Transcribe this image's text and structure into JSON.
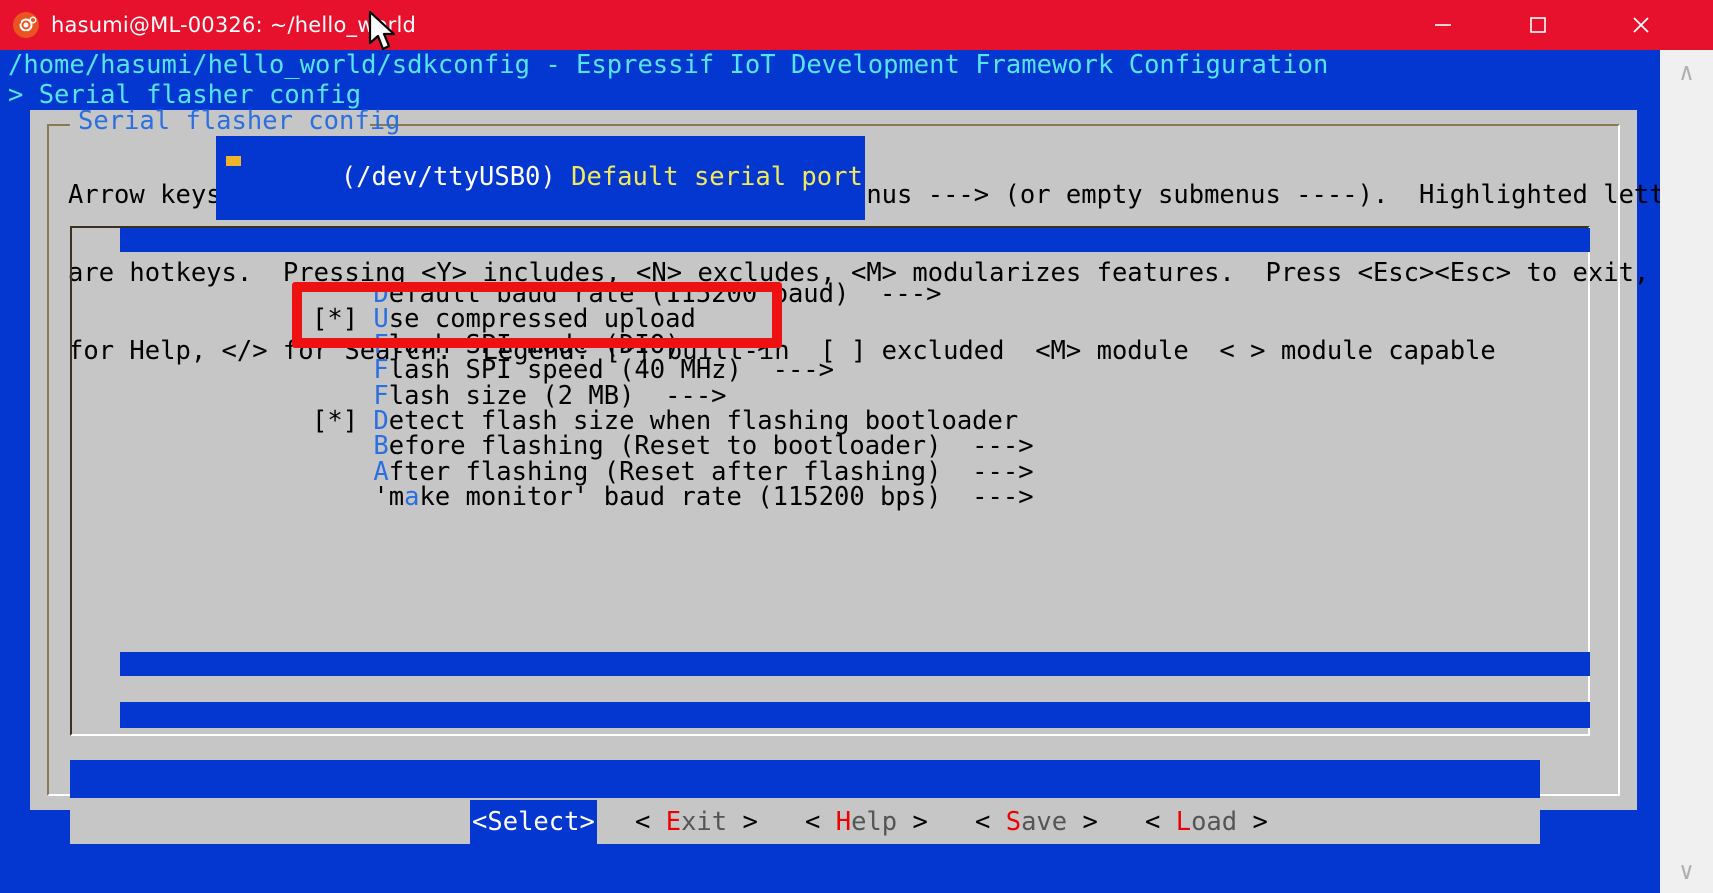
{
  "window": {
    "title": "hasumi@ML-00326: ~/hello_world",
    "logo_icon": "ubuntu-logo-icon",
    "titlebar_color": "#e8112d",
    "controls": {
      "minimize": "minimize-icon",
      "maximize": "maximize-icon",
      "close": "close-icon"
    }
  },
  "terminal": {
    "background": "#0437d0",
    "foreground": "#55e5f2",
    "path_line": "/home/hasumi/hello_world/sdkconfig - Espressif IoT Development Framework Configuration",
    "breadcrumb_line": "> Serial flasher config"
  },
  "dialog": {
    "title": "Serial flasher config",
    "title_color": "#2b6fe0",
    "background": "#c6c6c6",
    "help_lines": [
      "Arrow keys navigate the menu.  <Enter> selects submenus ---> (or empty submenus ----).  Highlighted letters",
      "are hotkeys.  Pressing <Y> includes, <N> excludes, <M> modularizes features.  Press <Esc><Esc> to exit, <?>",
      "for Help, </> for Search.  Legend: [*] built-in  [ ] excluded  <M> module  < > module capable"
    ]
  },
  "menu": {
    "selected_index": 0,
    "selected_row": {
      "value": "(/dev/ttyUSB0)",
      "label": "Default serial port",
      "highlight_color": "#0437d0",
      "value_color": "#ffffff",
      "label_color": "#f2e85c"
    },
    "items": [
      {
        "prefix": "    ",
        "hotkey": "D",
        "text": "efault baud rate (115200 baud)",
        "suffix": "  --->"
      },
      {
        "prefix": "[*] ",
        "hotkey": "U",
        "text": "se compressed upload",
        "suffix": ""
      },
      {
        "prefix": "    ",
        "hotkey": "F",
        "text": "lash SPI mode (DIO)",
        "suffix": "  --->"
      },
      {
        "prefix": "    ",
        "hotkey": "F",
        "text": "lash SPI speed (40 MHz)",
        "suffix": "  --->"
      },
      {
        "prefix": "    ",
        "hotkey": "F",
        "text": "lash size (2 MB)",
        "suffix": "  --->"
      },
      {
        "prefix": "[*] ",
        "hotkey": "D",
        "text": "etect flash size when flashing bootloader",
        "suffix": ""
      },
      {
        "prefix": "    ",
        "hotkey": "B",
        "text": "efore flashing (Reset to bootloader)",
        "suffix": "  --->"
      },
      {
        "prefix": "    ",
        "hotkey": "A",
        "text": "fter flashing (Reset after flashing)",
        "suffix": "  --->"
      },
      {
        "prefix": "    'm",
        "hotkey": "a",
        "text": "ke monitor' baud rate (115200 bps)",
        "suffix": "  --->"
      }
    ]
  },
  "buttons": [
    {
      "name": "select",
      "open": "<",
      "hotkey": "S",
      "rest": "elect",
      "close": ">",
      "selected": true
    },
    {
      "name": "exit",
      "open": "< ",
      "hotkey": "E",
      "rest": "xit",
      "close": " >",
      "selected": false
    },
    {
      "name": "help",
      "open": "< ",
      "hotkey": "H",
      "rest": "elp",
      "close": " >",
      "selected": false
    },
    {
      "name": "save",
      "open": "< ",
      "hotkey": "S",
      "rest": "ave",
      "close": " >",
      "selected": false
    },
    {
      "name": "load",
      "open": "< ",
      "hotkey": "L",
      "rest": "oad",
      "close": " >",
      "selected": false
    }
  ],
  "scrollbar": {
    "up_arrow": "chevron-up-icon",
    "down_arrow": "chevron-down-icon"
  },
  "annotation": {
    "shape": "rectangle",
    "color": "#ee1111",
    "targets": "default-serial-port-row"
  }
}
